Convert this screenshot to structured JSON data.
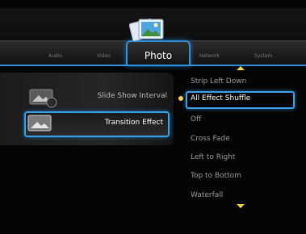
{
  "tabs": [
    {
      "label": "Audio"
    },
    {
      "label": "Video"
    },
    {
      "label": "Photo",
      "active": true
    },
    {
      "label": "Network"
    },
    {
      "label": "System"
    }
  ],
  "left_menu": [
    {
      "label": "Slide Show Interval",
      "icon": "photo-clock-icon"
    },
    {
      "label": "Transition Effect",
      "icon": "photo-effect-icon",
      "selected": true
    }
  ],
  "options": [
    {
      "label": "Strip Left Down"
    },
    {
      "label": "All Effect Shuffle",
      "selected": true
    },
    {
      "label": "Off"
    },
    {
      "label": "Cross Fade"
    },
    {
      "label": "Left to Right"
    },
    {
      "label": "Top to Bottom"
    },
    {
      "label": "Waterfall"
    }
  ],
  "colors": {
    "accent": "#2f8fd8",
    "selection_bullet": "#f4d64a",
    "background": "#050505"
  }
}
